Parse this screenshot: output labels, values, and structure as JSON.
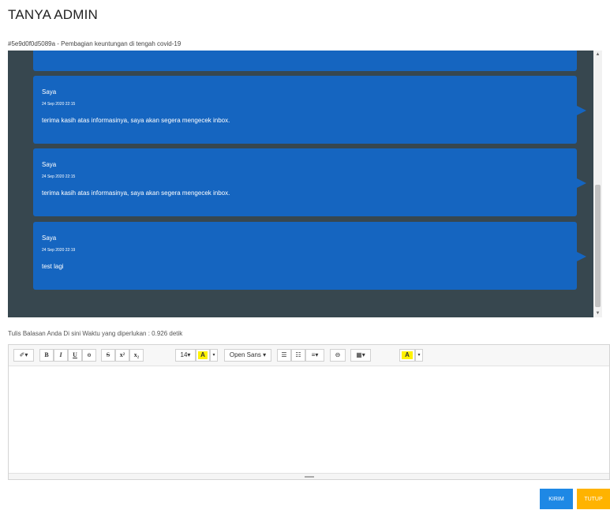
{
  "page": {
    "title": "TANYA ADMIN",
    "subject": "#5e9d0f0d5089a - Pembagian keuntungan di tengah covid-19",
    "reply_label": "Tulis Balasan Anda Di sini Waktu yang diperlukan : 0.926 detik"
  },
  "messages": [
    {
      "sender": "Saya",
      "time": "24 Sep 2020 22:15",
      "text": "terima kasih atas informasinya, saya akan segera mengecek inbox."
    },
    {
      "sender": "Saya",
      "time": "24 Sep 2020 22:15",
      "text": "terima kasih atas informasinya, saya akan segera mengecek inbox."
    },
    {
      "sender": "Saya",
      "time": "24 Sep 2020 22:19",
      "text": "test lagi"
    }
  ],
  "toolbar": {
    "magic": "✐▾",
    "bold": "B",
    "italic": "I",
    "underline": "U",
    "eraser": "ɵ",
    "strike": "S",
    "superscript": "x²",
    "subscript": "x₂",
    "fontsize": "14▾",
    "color_letter": "A",
    "color_caret": "▾",
    "font_family": "Open Sans ▾",
    "ul": "☰",
    "ol": "☷",
    "align": "≡▾",
    "link": "⊖",
    "table": "▦▾",
    "hilite_letter": "A",
    "hilite_caret": "▾"
  },
  "buttons": {
    "send": "KIRIM",
    "close": "TUTUP"
  },
  "colors": {
    "chat_bg": "#37474f",
    "bubble": "#1565c0",
    "send": "#1e88e5",
    "close": "#ffb300",
    "highlight": "#fff200"
  }
}
